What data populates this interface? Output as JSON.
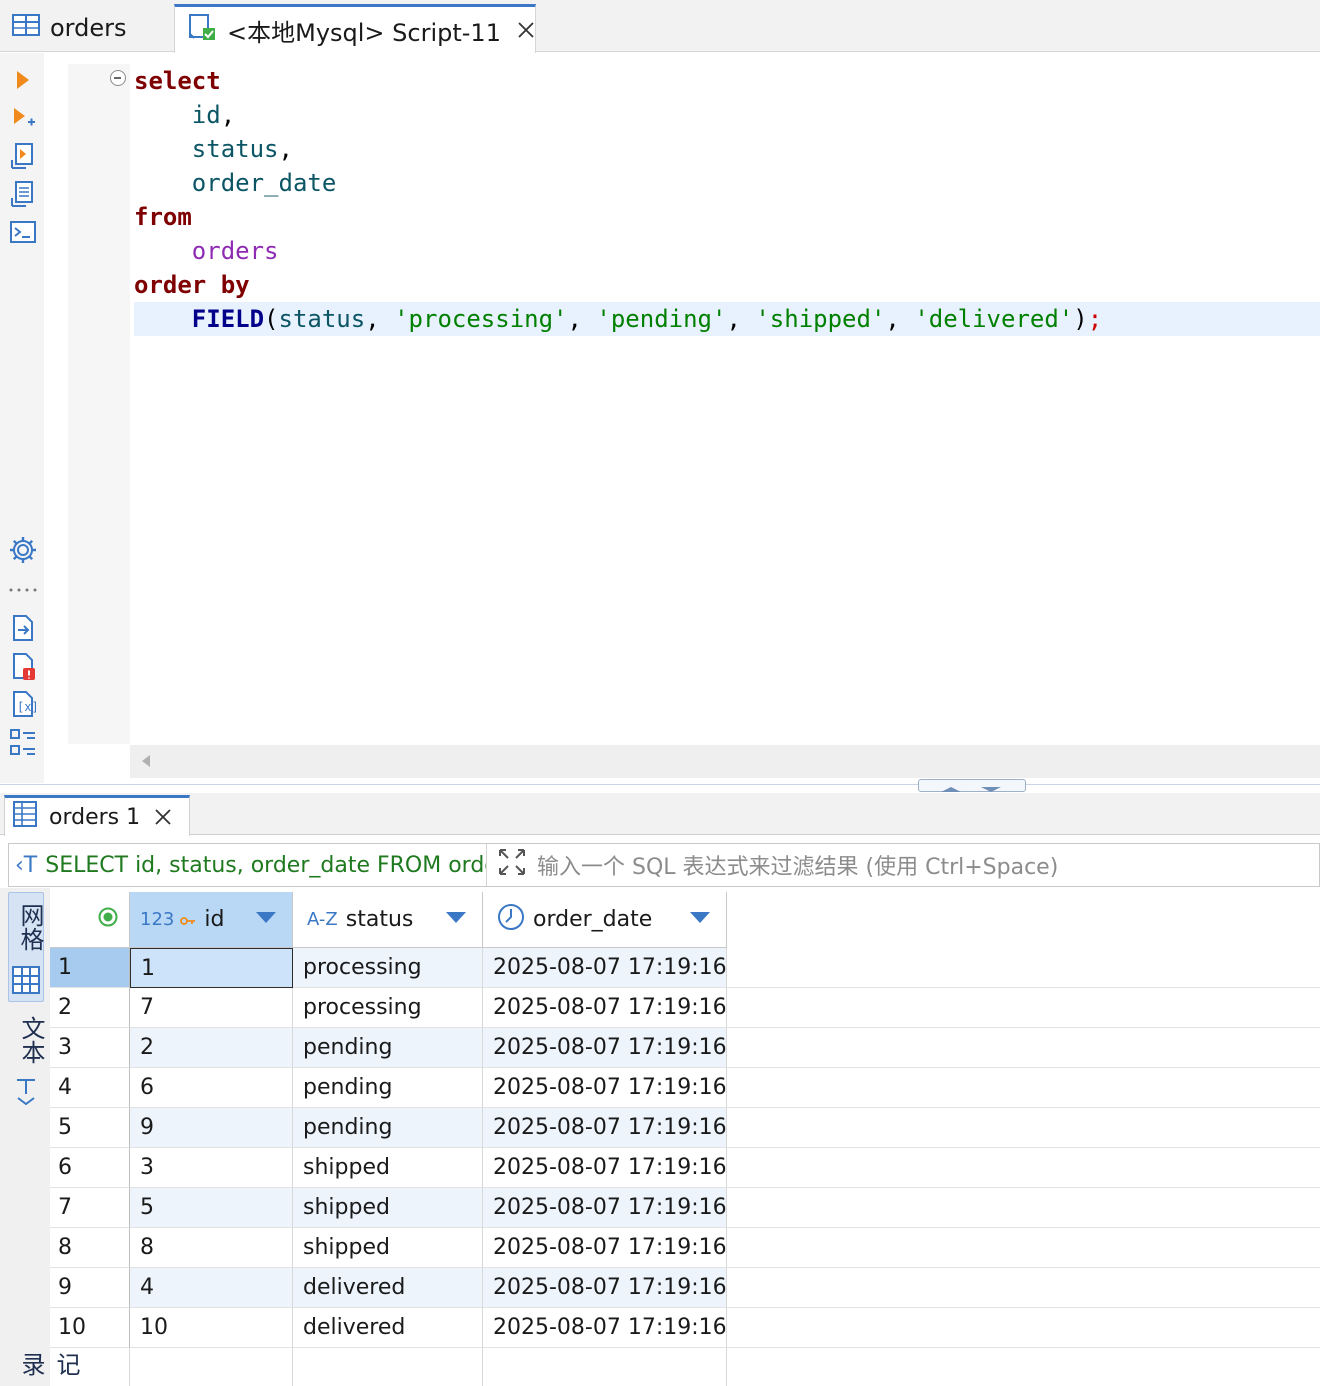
{
  "tabs": [
    {
      "label": "orders",
      "icon": "table-icon"
    },
    {
      "label": "<本地Mysql> Script-11",
      "icon": "sql-script-icon"
    }
  ],
  "editor": {
    "lines": [
      [
        {
          "t": "select",
          "c": "kw"
        }
      ],
      [
        {
          "t": "    "
        },
        {
          "t": "id",
          "c": "col"
        },
        {
          "t": ",",
          "c": "pun"
        }
      ],
      [
        {
          "t": "    "
        },
        {
          "t": "status",
          "c": "col"
        },
        {
          "t": ",",
          "c": "pun"
        }
      ],
      [
        {
          "t": "    "
        },
        {
          "t": "order_date",
          "c": "col"
        }
      ],
      [
        {
          "t": "from",
          "c": "kw"
        }
      ],
      [
        {
          "t": "    "
        },
        {
          "t": "orders",
          "c": "tbl"
        }
      ],
      [
        {
          "t": "order by",
          "c": "kw"
        }
      ],
      [
        {
          "t": "    "
        },
        {
          "t": "FIELD",
          "c": "fn"
        },
        {
          "t": "(",
          "c": "pun"
        },
        {
          "t": "status",
          "c": "col"
        },
        {
          "t": ", ",
          "c": "pun"
        },
        {
          "t": "'processing'",
          "c": "str"
        },
        {
          "t": ", ",
          "c": "pun"
        },
        {
          "t": "'pending'",
          "c": "str"
        },
        {
          "t": ", ",
          "c": "pun"
        },
        {
          "t": "'shipped'",
          "c": "str"
        },
        {
          "t": ", ",
          "c": "pun"
        },
        {
          "t": "'delivered'",
          "c": "str"
        },
        {
          "t": ")",
          "c": "pun"
        },
        {
          "t": ";",
          "c": "semi"
        }
      ]
    ]
  },
  "result": {
    "tab_label": "orders 1",
    "sql_text": "SELECT id, status, order_date FROM orders",
    "filter_placeholder": "输入一个 SQL 表达式来过滤结果 (使用 Ctrl+Space)",
    "side_tabs": {
      "grid": "网格",
      "text": "文本",
      "record": "记录"
    },
    "columns": [
      {
        "type": "123",
        "name": "id"
      },
      {
        "type": "A-Z",
        "name": "status"
      },
      {
        "type": "",
        "name": "order_date"
      }
    ],
    "rows": [
      {
        "n": "1",
        "id": "1",
        "status": "processing",
        "order_date": "2025-08-07 17:19:16"
      },
      {
        "n": "2",
        "id": "7",
        "status": "processing",
        "order_date": "2025-08-07 17:19:16"
      },
      {
        "n": "3",
        "id": "2",
        "status": "pending",
        "order_date": "2025-08-07 17:19:16"
      },
      {
        "n": "4",
        "id": "6",
        "status": "pending",
        "order_date": "2025-08-07 17:19:16"
      },
      {
        "n": "5",
        "id": "9",
        "status": "pending",
        "order_date": "2025-08-07 17:19:16"
      },
      {
        "n": "6",
        "id": "3",
        "status": "shipped",
        "order_date": "2025-08-07 17:19:16"
      },
      {
        "n": "7",
        "id": "5",
        "status": "shipped",
        "order_date": "2025-08-07 17:19:16"
      },
      {
        "n": "8",
        "id": "8",
        "status": "shipped",
        "order_date": "2025-08-07 17:19:16"
      },
      {
        "n": "9",
        "id": "4",
        "status": "delivered",
        "order_date": "2025-08-07 17:19:16"
      },
      {
        "n": "10",
        "id": "10",
        "status": "delivered",
        "order_date": "2025-08-07 17:19:16"
      }
    ]
  },
  "colors": {
    "accent": "#3a78c6",
    "keyword": "#7f0000",
    "string": "#008000"
  }
}
